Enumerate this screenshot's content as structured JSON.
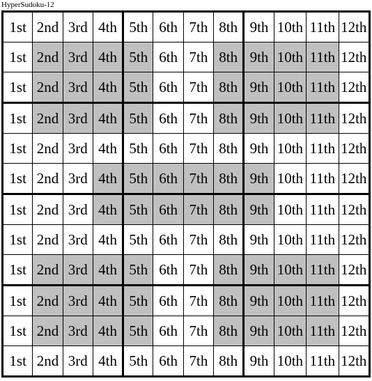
{
  "page": {
    "title": "HyperSudoku-12"
  },
  "grid": {
    "rows": 12,
    "columns": 12,
    "block_rows": 3,
    "block_cols": 4,
    "colors": {
      "shaded_cell": "#c0c0c0",
      "plain_cell": "#ffffff",
      "grid_line": "#000000",
      "text": "#000000"
    },
    "column_labels": [
      "1st",
      "2nd",
      "3rd",
      "4th",
      "5th",
      "6th",
      "7th",
      "8th",
      "9th",
      "10th",
      "11th",
      "12th"
    ],
    "cells": [
      [
        "1st",
        "2nd",
        "3rd",
        "4th",
        "5th",
        "6th",
        "7th",
        "8th",
        "9th",
        "10th",
        "11th",
        "12th"
      ],
      [
        "1st",
        "2nd",
        "3rd",
        "4th",
        "5th",
        "6th",
        "7th",
        "8th",
        "9th",
        "10th",
        "11th",
        "12th"
      ],
      [
        "1st",
        "2nd",
        "3rd",
        "4th",
        "5th",
        "6th",
        "7th",
        "8th",
        "9th",
        "10th",
        "11th",
        "12th"
      ],
      [
        "1st",
        "2nd",
        "3rd",
        "4th",
        "5th",
        "6th",
        "7th",
        "8th",
        "9th",
        "10th",
        "11th",
        "12th"
      ],
      [
        "1st",
        "2nd",
        "3rd",
        "4th",
        "5th",
        "6th",
        "7th",
        "8th",
        "9th",
        "10th",
        "11th",
        "12th"
      ],
      [
        "1st",
        "2nd",
        "3rd",
        "4th",
        "5th",
        "6th",
        "7th",
        "8th",
        "9th",
        "10th",
        "11th",
        "12th"
      ],
      [
        "1st",
        "2nd",
        "3rd",
        "4th",
        "5th",
        "6th",
        "7th",
        "8th",
        "9th",
        "10th",
        "11th",
        "12th"
      ],
      [
        "1st",
        "2nd",
        "3rd",
        "4th",
        "5th",
        "6th",
        "7th",
        "8th",
        "9th",
        "10th",
        "11th",
        "12th"
      ],
      [
        "1st",
        "2nd",
        "3rd",
        "4th",
        "5th",
        "6th",
        "7th",
        "8th",
        "9th",
        "10th",
        "11th",
        "12th"
      ],
      [
        "1st",
        "2nd",
        "3rd",
        "4th",
        "5th",
        "6th",
        "7th",
        "8th",
        "9th",
        "10th",
        "11th",
        "12th"
      ],
      [
        "1st",
        "2nd",
        "3rd",
        "4th",
        "5th",
        "6th",
        "7th",
        "8th",
        "9th",
        "10th",
        "11th",
        "12th"
      ],
      [
        "1st",
        "2nd",
        "3rd",
        "4th",
        "5th",
        "6th",
        "7th",
        "8th",
        "9th",
        "10th",
        "11th",
        "12th"
      ]
    ],
    "shaded": [
      [
        false,
        false,
        false,
        false,
        false,
        false,
        false,
        false,
        false,
        false,
        false,
        false
      ],
      [
        false,
        true,
        true,
        true,
        true,
        false,
        false,
        true,
        true,
        true,
        true,
        false
      ],
      [
        false,
        true,
        true,
        true,
        true,
        false,
        false,
        true,
        true,
        true,
        true,
        false
      ],
      [
        false,
        true,
        true,
        true,
        true,
        false,
        false,
        true,
        true,
        true,
        true,
        false
      ],
      [
        false,
        false,
        false,
        false,
        false,
        false,
        false,
        false,
        false,
        false,
        false,
        false
      ],
      [
        false,
        false,
        false,
        true,
        true,
        true,
        true,
        true,
        true,
        false,
        false,
        false
      ],
      [
        false,
        false,
        false,
        true,
        true,
        true,
        true,
        true,
        true,
        false,
        false,
        false
      ],
      [
        false,
        false,
        false,
        false,
        false,
        false,
        false,
        false,
        false,
        false,
        false,
        false
      ],
      [
        false,
        true,
        true,
        true,
        true,
        false,
        false,
        true,
        true,
        true,
        true,
        false
      ],
      [
        false,
        true,
        true,
        true,
        true,
        false,
        false,
        true,
        true,
        true,
        true,
        false
      ],
      [
        false,
        true,
        true,
        true,
        true,
        false,
        false,
        true,
        true,
        true,
        true,
        false
      ],
      [
        false,
        false,
        false,
        false,
        false,
        false,
        false,
        false,
        false,
        false,
        false,
        false
      ]
    ],
    "column_width_pct": [
      8.3,
      8.3,
      8.3,
      8.3,
      8.3,
      8.3,
      8.3,
      8.3,
      8.3,
      8.9,
      8.9,
      8.5
    ],
    "thick_vertical_after_columns": [
      4,
      8
    ],
    "thick_horizontal_after_rows": [
      3,
      6,
      9
    ]
  }
}
